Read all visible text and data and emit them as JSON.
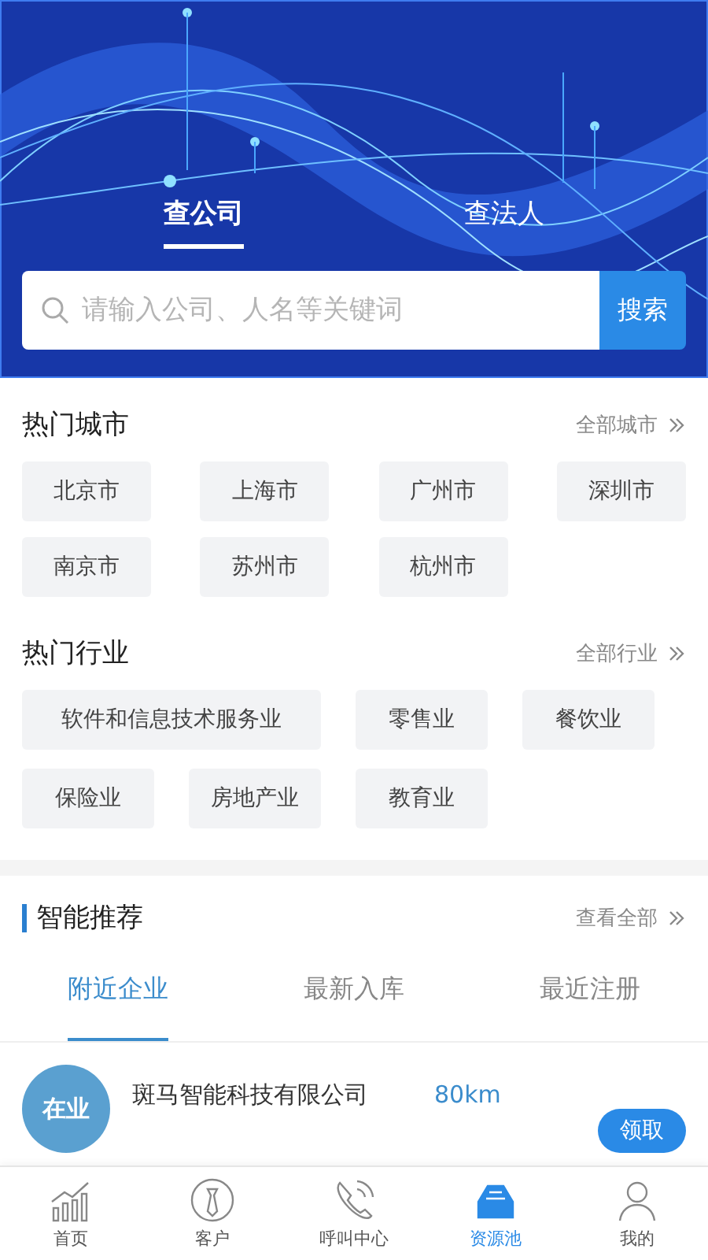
{
  "search_tabs": [
    {
      "label": "查公司",
      "selected": true
    },
    {
      "label": "查法人",
      "selected": false
    }
  ],
  "search": {
    "placeholder": "请输入公司、人名等关键词",
    "button": "搜索"
  },
  "hot_cities": {
    "title": "热门城市",
    "more": "全部城市",
    "items": [
      "北京市",
      "上海市",
      "广州市",
      "深圳市",
      "南京市",
      "苏州市",
      "杭州市"
    ]
  },
  "hot_industries": {
    "title": "热门行业",
    "more": "全部行业",
    "items": [
      "软件和信息技术服务业",
      "零售业",
      "餐饮业",
      "保险业",
      "房地产业",
      "教育业"
    ]
  },
  "recommend": {
    "title": "智能推荐",
    "more": "查看全部",
    "tabs": [
      {
        "label": "附近企业",
        "selected": true
      },
      {
        "label": "最新入库",
        "selected": false
      },
      {
        "label": "最近注册",
        "selected": false
      }
    ],
    "companies": [
      {
        "status": "在业",
        "name": "斑马智能科技有限公司",
        "distance": "80km",
        "action": "领取"
      }
    ]
  },
  "nav": [
    {
      "label": "首页",
      "selected": false
    },
    {
      "label": "客户",
      "selected": false
    },
    {
      "label": "呼叫中心",
      "selected": false
    },
    {
      "label": "资源池",
      "selected": true
    },
    {
      "label": "我的",
      "selected": false
    }
  ]
}
